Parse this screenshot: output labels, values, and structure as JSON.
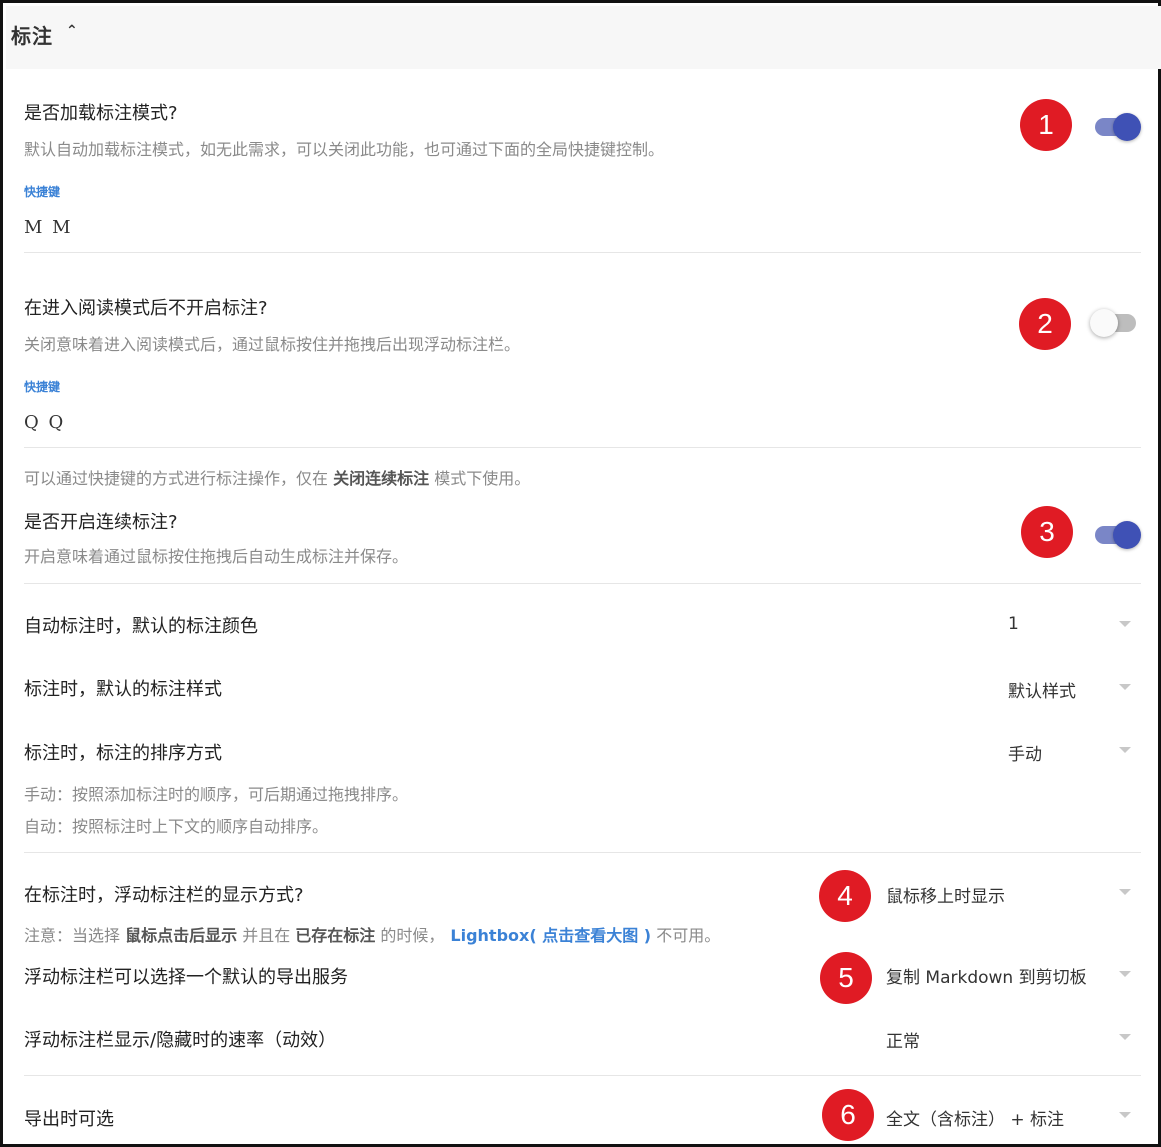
{
  "header": {
    "title": "标注",
    "chevron": "⌃"
  },
  "sections": {
    "load_mode": {
      "question": "是否加载标注模式?",
      "description": "默认自动加载标注模式，如无此需求，可以关闭此功能，也可通过下面的全局快捷键控制。",
      "shortcut_label": "快捷键",
      "shortcut_value": "M M",
      "badge": "1",
      "toggle_on": true
    },
    "read_mode": {
      "question": "在进入阅读模式后不开启标注?",
      "description": "关闭意味着进入阅读模式后，通过鼠标按住并拖拽后出现浮动标注栏。",
      "shortcut_label": "快捷键",
      "shortcut_value": "Q Q",
      "badge": "2",
      "toggle_on": false
    },
    "shortcut_note": {
      "before": "可以通过快捷键的方式进行标注操作，仅在 ",
      "bold": "关闭连续标注",
      "after": " 模式下使用。"
    },
    "continuous": {
      "question": "是否开启连续标注?",
      "description": "开启意味着通过鼠标按住拖拽后自动生成标注并保存。",
      "badge": "3",
      "toggle_on": true
    },
    "default_color": {
      "label": "自动标注时，默认的标注颜色",
      "value": "1"
    },
    "default_style": {
      "label": "标注时，默认的标注样式",
      "value": "默认样式"
    },
    "sort_mode": {
      "label": "标注时，标注的排序方式",
      "value": "手动",
      "note_manual": "手动：按照添加标注时的顺序，可后期通过拖拽排序。",
      "note_auto": "自动：按照标注时上下文的顺序自动排序。"
    },
    "float_display": {
      "label": "在标注时，浮动标注栏的显示方式?",
      "value": "鼠标移上时显示",
      "badge": "4",
      "note_prefix": "注意：当选择 ",
      "note_bold1": "鼠标点击后显示",
      "note_mid": " 并且在 ",
      "note_bold2": "已存在标注",
      "note_mid2": " 的时候，",
      "note_link": "Lightbox( 点击查看大图 )",
      "note_suffix": " 不可用。"
    },
    "export_service": {
      "label": "浮动标注栏可以选择一个默认的导出服务",
      "value": "复制 Markdown 到剪切板",
      "badge": "5"
    },
    "animation_speed": {
      "label": "浮动标注栏显示/隐藏时的速率（动效）",
      "value": "正常"
    },
    "export_option": {
      "label": "导出时可选",
      "value": "全文（含标注） + 标注",
      "badge": "6"
    }
  },
  "colors": {
    "accent": "#3f51b5",
    "badge": "#e01b24",
    "link": "#3b82d6"
  },
  "icons": {
    "caret": "caret-down-icon",
    "chevron": "chevron-up-icon"
  }
}
